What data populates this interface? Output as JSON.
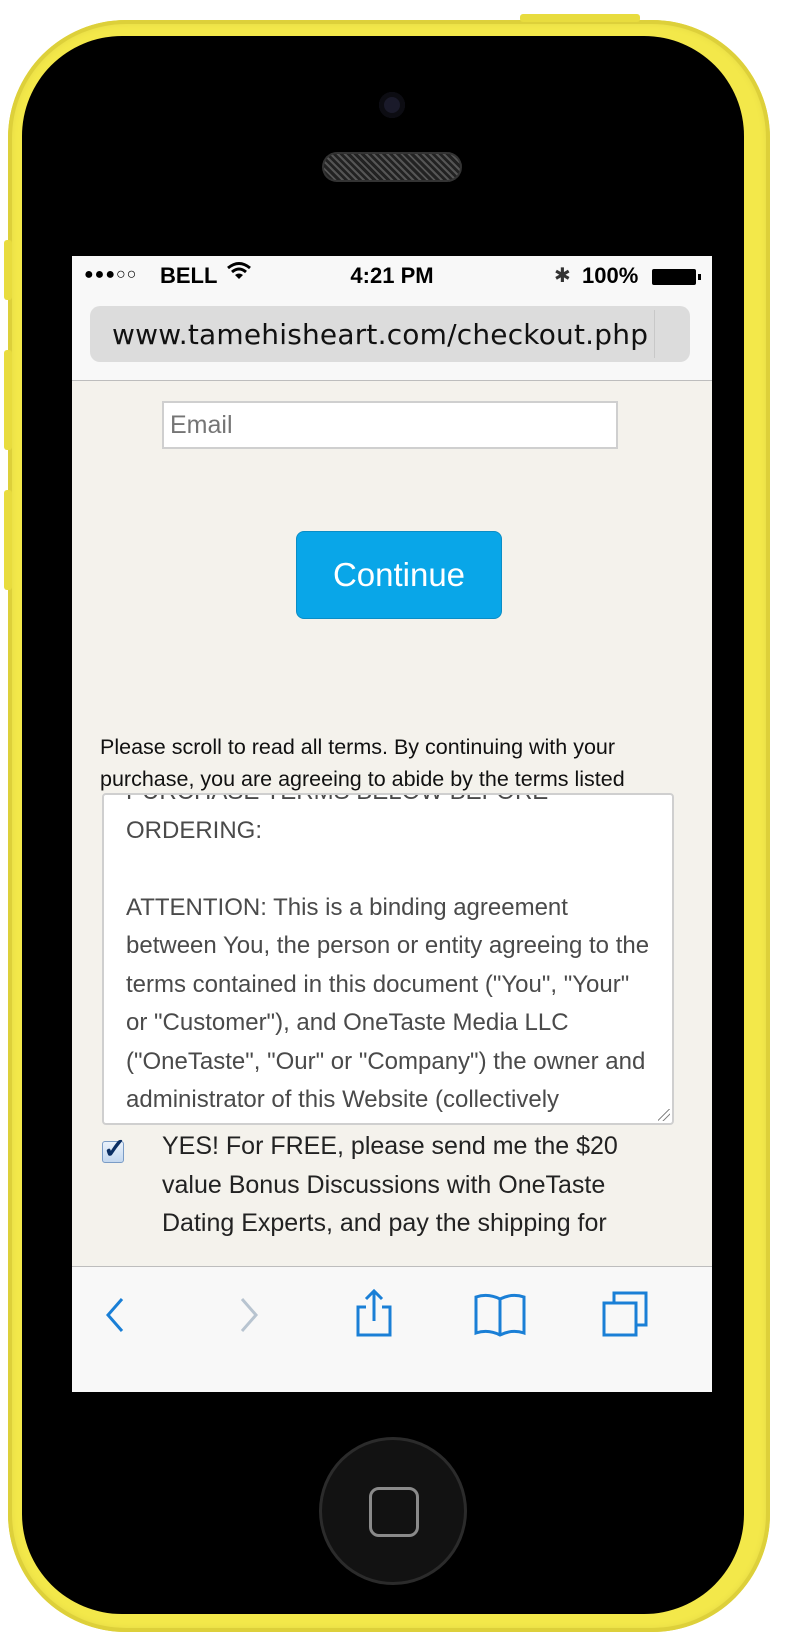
{
  "status_bar": {
    "signal": "●●●○○",
    "carrier": "BELL",
    "time": "4:21 PM",
    "battery": "100%"
  },
  "browser": {
    "url": "www.tamehisheart.com/checkout.php"
  },
  "form": {
    "email_placeholder": "Email",
    "continue_label": "Continue",
    "terms_intro": "Please scroll to read all terms. By continuing with your purchase, you are agreeing to abide by the terms listed",
    "terms_text": "PURCHASE TERMS BELOW BEFORE ORDERING:\n\nATTENTION: This is a binding agreement between You, the person or entity agreeing to the terms contained in this document (\"You\", \"Your\" or \"Customer\"), and OneTaste Media LLC (\"OneTaste\", \"Our\" or \"Company\") the owner and administrator of this Website (collectively",
    "bonus_checked": true,
    "bonus_text": "YES! For FREE, please send me the $20 value Bonus Discussions with OneTaste Dating Experts, and pay the shipping for"
  },
  "colors": {
    "accent": "#09a6e8",
    "phone_case": "#f3e84a",
    "toolbar_icon": "#1a7fd6"
  },
  "icons": [
    "back-icon",
    "forward-icon",
    "share-icon",
    "bookmarks-icon",
    "tabs-icon"
  ]
}
